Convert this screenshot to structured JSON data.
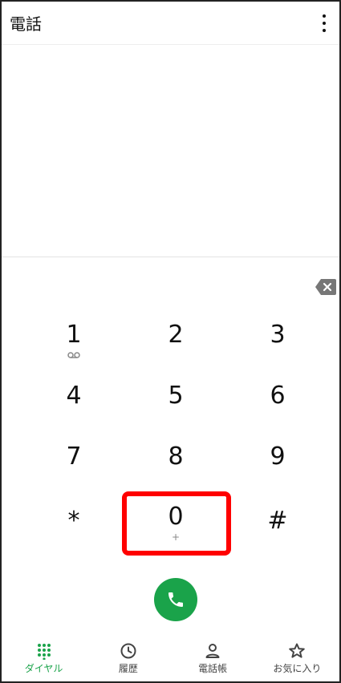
{
  "app": {
    "title": "電話"
  },
  "keypad": {
    "keys": [
      {
        "digit": "1",
        "sub": "voicemail"
      },
      {
        "digit": "2",
        "sub": ""
      },
      {
        "digit": "3",
        "sub": ""
      },
      {
        "digit": "4",
        "sub": ""
      },
      {
        "digit": "5",
        "sub": ""
      },
      {
        "digit": "6",
        "sub": ""
      },
      {
        "digit": "7",
        "sub": ""
      },
      {
        "digit": "8",
        "sub": ""
      },
      {
        "digit": "9",
        "sub": ""
      },
      {
        "digit": "*",
        "sub": ""
      },
      {
        "digit": "0",
        "sub": "+"
      },
      {
        "digit": "#",
        "sub": ""
      }
    ]
  },
  "bottom_nav": {
    "items": [
      {
        "label": "ダイヤル",
        "icon": "dialpad-icon",
        "active": true
      },
      {
        "label": "履歴",
        "icon": "clock-icon",
        "active": false
      },
      {
        "label": "電話帳",
        "icon": "person-icon",
        "active": false
      },
      {
        "label": "お気に入り",
        "icon": "star-icon",
        "active": false
      }
    ]
  },
  "colors": {
    "accent": "#1aa34a",
    "highlight": "#ff0000"
  }
}
